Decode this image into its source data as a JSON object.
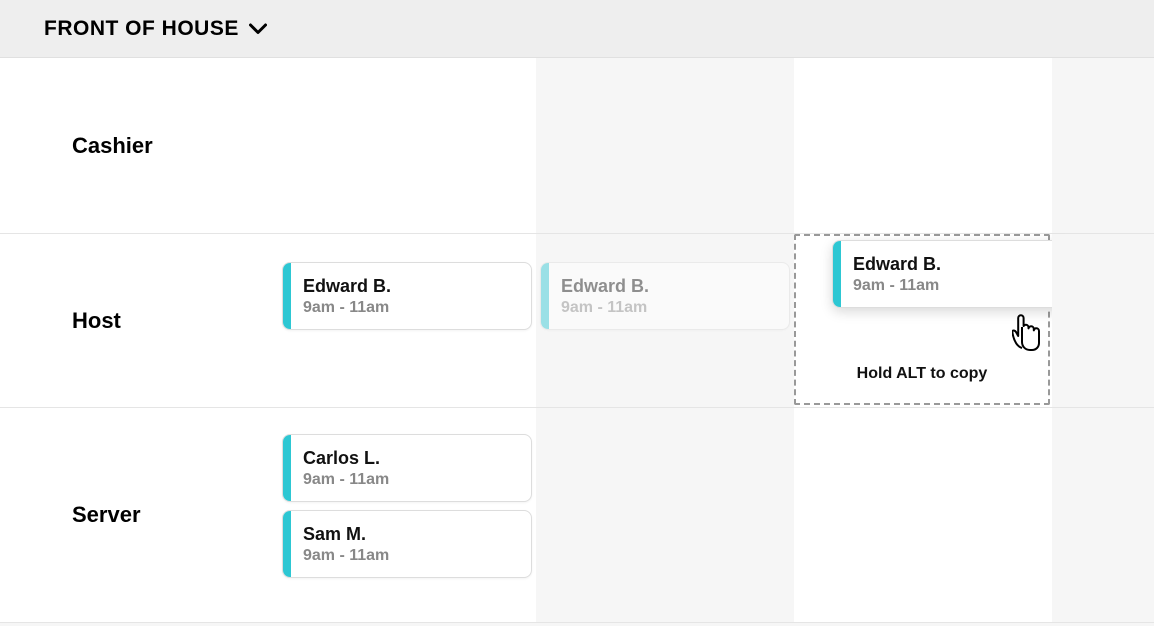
{
  "header": {
    "title": "FRONT OF HOUSE"
  },
  "roles": {
    "cashier": "Cashier",
    "host": "Host",
    "server": "Server"
  },
  "shifts": {
    "host_col1": {
      "name": "Edward B.",
      "time": "9am - 11am"
    },
    "host_col2_ghost": {
      "name": "Edward B.",
      "time": "9am - 11am"
    },
    "host_col3_drag": {
      "name": "Edward B.",
      "time": "9am - 11am"
    },
    "server_col1_a": {
      "name": "Carlos L.",
      "time": "9am - 11am"
    },
    "server_col1_b": {
      "name": "Sam M.",
      "time": "9am - 11am"
    }
  },
  "drop_hint": "Hold ALT to copy"
}
